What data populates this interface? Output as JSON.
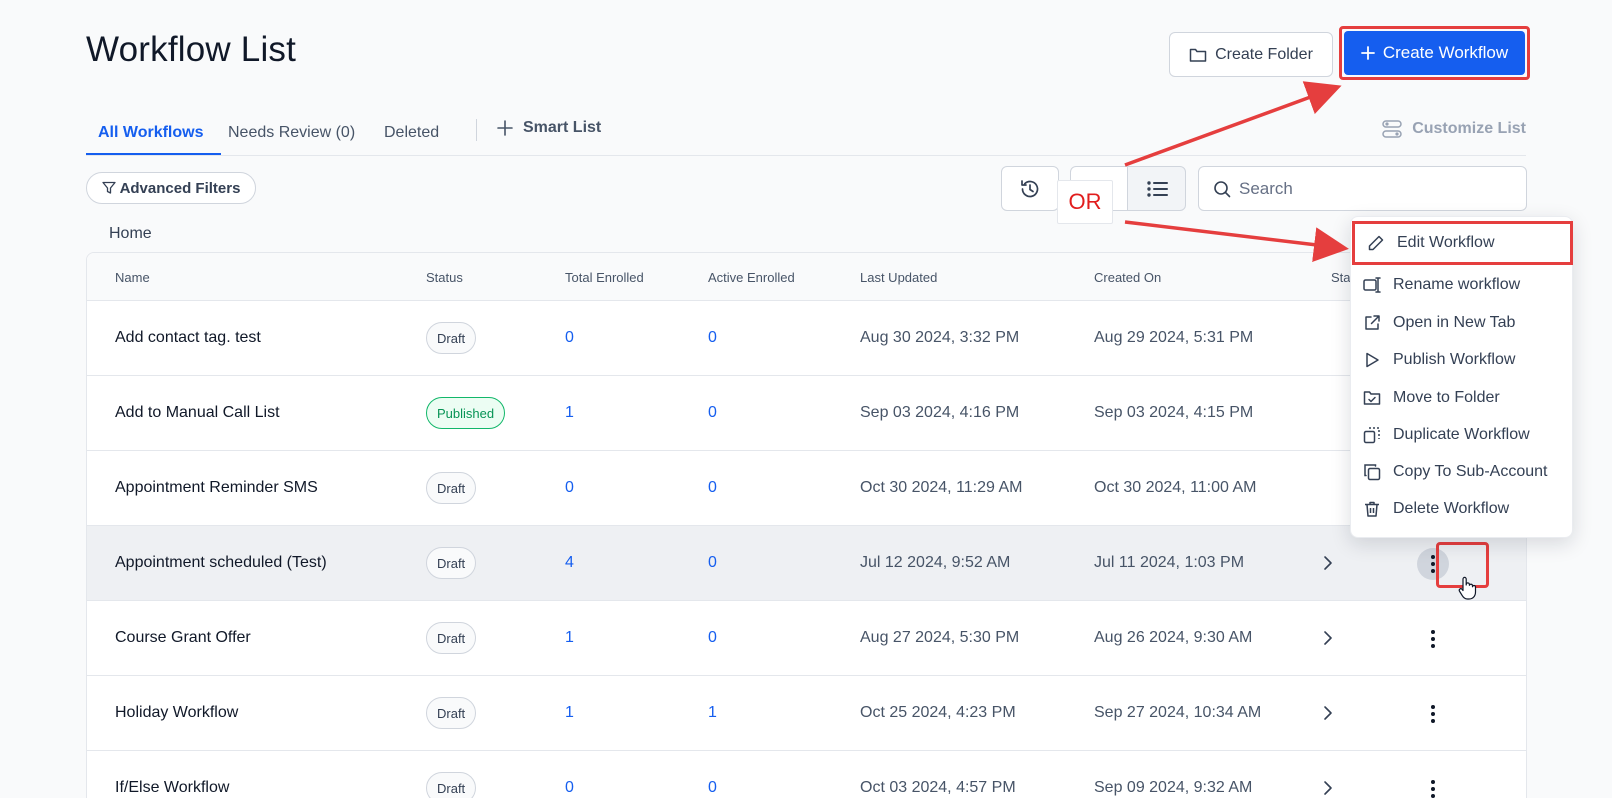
{
  "page": {
    "title": "Workflow List"
  },
  "header": {
    "create_folder_label": "Create Folder",
    "create_workflow_label": "Create Workflow"
  },
  "tabs": [
    {
      "label": "All Workflows",
      "active": true
    },
    {
      "label": "Needs Review (0)",
      "active": false
    },
    {
      "label": "Deleted",
      "active": false
    }
  ],
  "smart_list_label": "Smart List",
  "customize_label": "Customize List",
  "filters": {
    "advanced_label": "Advanced Filters"
  },
  "search": {
    "placeholder": "Search"
  },
  "annotation": {
    "or_label": "OR",
    "color": "#e53e3e"
  },
  "breadcrumb": "Home",
  "table": {
    "columns": [
      "Name",
      "Status",
      "Total Enrolled",
      "Active Enrolled",
      "Last Updated",
      "Created On",
      "Sta"
    ],
    "rows": [
      {
        "name": "Add contact tag. test",
        "status": "Draft",
        "total": "0",
        "active": "0",
        "updated": "Aug 30 2024, 3:32 PM",
        "created": "Aug 29 2024, 5:31 PM"
      },
      {
        "name": "Add to Manual Call List",
        "status": "Published",
        "total": "1",
        "active": "0",
        "updated": "Sep 03 2024, 4:16 PM",
        "created": "Sep 03 2024, 4:15 PM"
      },
      {
        "name": "Appointment Reminder SMS",
        "status": "Draft",
        "total": "0",
        "active": "0",
        "updated": "Oct 30 2024, 11:29 AM",
        "created": "Oct 30 2024, 11:00 AM"
      },
      {
        "name": "Appointment scheduled (Test)",
        "status": "Draft",
        "total": "4",
        "active": "0",
        "updated": "Jul 12 2024, 9:52 AM",
        "created": "Jul 11 2024, 1:03 PM"
      },
      {
        "name": "Course Grant Offer",
        "status": "Draft",
        "total": "1",
        "active": "0",
        "updated": "Aug 27 2024, 5:30 PM",
        "created": "Aug 26 2024, 9:30 AM"
      },
      {
        "name": "Holiday Workflow",
        "status": "Draft",
        "total": "1",
        "active": "1",
        "updated": "Oct 25 2024, 4:23 PM",
        "created": "Sep 27 2024, 10:34 AM"
      },
      {
        "name": "If/Else Workflow",
        "status": "Draft",
        "total": "0",
        "active": "0",
        "updated": "Oct 03 2024, 4:57 PM",
        "created": "Sep 09 2024, 9:32 AM"
      }
    ]
  },
  "menu": {
    "items": [
      {
        "label": "Edit Workflow",
        "icon": "pencil-icon"
      },
      {
        "label": "Rename workflow",
        "icon": "rename-icon"
      },
      {
        "label": "Open in New Tab",
        "icon": "external-link-icon"
      },
      {
        "label": "Publish Workflow",
        "icon": "play-icon"
      },
      {
        "label": "Move to Folder",
        "icon": "folder-move-icon"
      },
      {
        "label": "Duplicate Workflow",
        "icon": "duplicate-icon"
      },
      {
        "label": "Copy To Sub-Account",
        "icon": "copy-icon"
      },
      {
        "label": "Delete Workflow",
        "icon": "trash-icon"
      }
    ]
  },
  "colors": {
    "accent": "#155eef",
    "highlight": "#e53e3e",
    "published": "#12b76a"
  }
}
